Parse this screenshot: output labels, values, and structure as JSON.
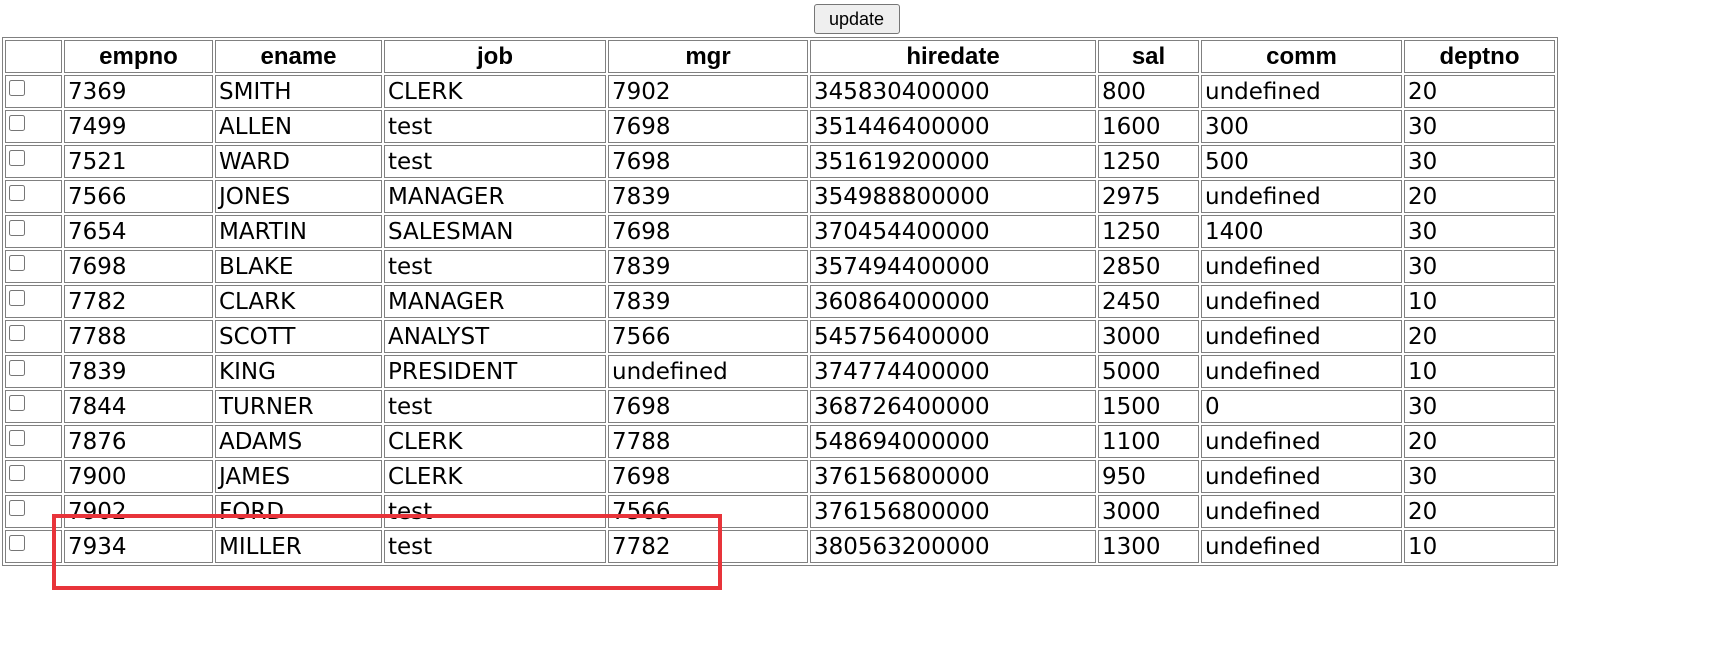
{
  "toolbar": {
    "update_label": "update"
  },
  "table": {
    "columns": [
      "",
      "empno",
      "ename",
      "job",
      "mgr",
      "hiredate",
      "sal",
      "comm",
      "deptno"
    ],
    "rows": [
      [
        "7369",
        "SMITH",
        "CLERK",
        "7902",
        "345830400000",
        "800",
        "undefined",
        "20"
      ],
      [
        "7499",
        "ALLEN",
        "test",
        "7698",
        "351446400000",
        "1600",
        "300",
        "30"
      ],
      [
        "7521",
        "WARD",
        "test",
        "7698",
        "351619200000",
        "1250",
        "500",
        "30"
      ],
      [
        "7566",
        "JONES",
        "MANAGER",
        "7839",
        "354988800000",
        "2975",
        "undefined",
        "20"
      ],
      [
        "7654",
        "MARTIN",
        "SALESMAN",
        "7698",
        "370454400000",
        "1250",
        "1400",
        "30"
      ],
      [
        "7698",
        "BLAKE",
        "test",
        "7839",
        "357494400000",
        "2850",
        "undefined",
        "30"
      ],
      [
        "7782",
        "CLARK",
        "MANAGER",
        "7839",
        "360864000000",
        "2450",
        "undefined",
        "10"
      ],
      [
        "7788",
        "SCOTT",
        "ANALYST",
        "7566",
        "545756400000",
        "3000",
        "undefined",
        "20"
      ],
      [
        "7839",
        "KING",
        "PRESIDENT",
        "undefined",
        "374774400000",
        "5000",
        "undefined",
        "10"
      ],
      [
        "7844",
        "TURNER",
        "test",
        "7698",
        "368726400000",
        "1500",
        "0",
        "30"
      ],
      [
        "7876",
        "ADAMS",
        "CLERK",
        "7788",
        "548694000000",
        "1100",
        "undefined",
        "20"
      ],
      [
        "7900",
        "JAMES",
        "CLERK",
        "7698",
        "376156800000",
        "950",
        "undefined",
        "30"
      ],
      [
        "7902",
        "FORD",
        "test",
        "7566",
        "376156800000",
        "3000",
        "undefined",
        "20"
      ],
      [
        "7934",
        "MILLER",
        "test",
        "7782",
        "380563200000",
        "1300",
        "undefined",
        "10"
      ]
    ]
  },
  "annotation": {
    "highlight_color": "#e8343a"
  }
}
